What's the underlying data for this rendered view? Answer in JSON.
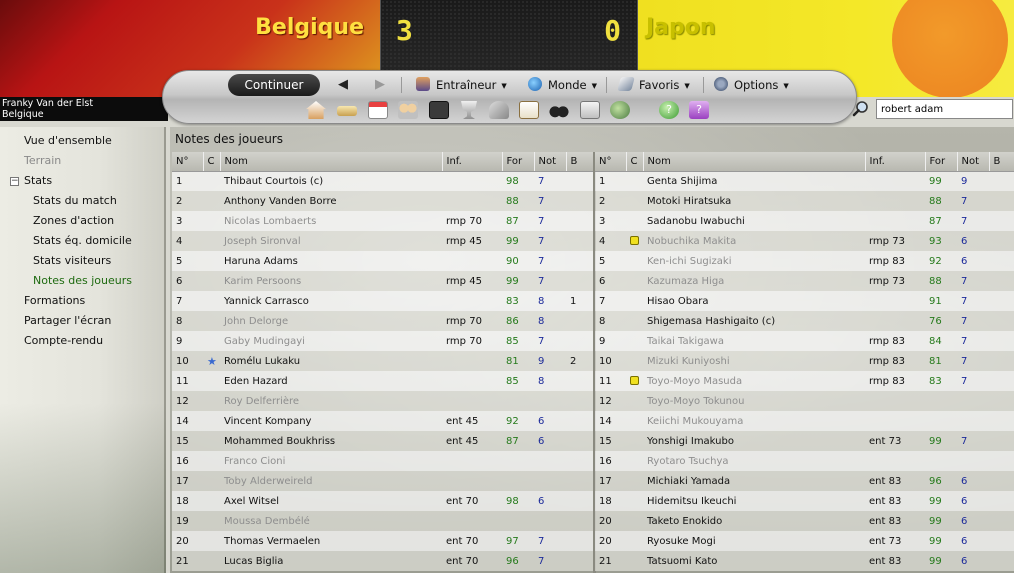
{
  "match": {
    "home_team": "Belgique",
    "away_team": "Japon",
    "home_score": "3",
    "away_score": "0",
    "colors": {
      "home": "#c81a14",
      "away": "#f0e020",
      "score_text": "#f0e040"
    }
  },
  "manager": {
    "name": "Franky Van der Elst",
    "team": "Belgique"
  },
  "toolbar": {
    "continue_label": "Continuer",
    "menus": [
      "Entraîneur",
      "Monde",
      "Favoris",
      "Options"
    ],
    "icons": [
      "home-icon",
      "money-icon",
      "calendar-icon",
      "squad-icon",
      "tactics-icon",
      "trophy-icon",
      "staff-icon",
      "clipboard-icon",
      "scout-icon",
      "news-icon",
      "globe-icon",
      "help-icon",
      "info-icon"
    ]
  },
  "search": {
    "value": "robert adam"
  },
  "sidebar": {
    "items": [
      {
        "label": "Vue d'ensemble",
        "state": "normal"
      },
      {
        "label": "Terrain",
        "state": "disabled"
      },
      {
        "label": "Stats",
        "state": "expanded"
      },
      {
        "label": "Stats du match",
        "state": "normal"
      },
      {
        "label": "Zones d'action",
        "state": "normal"
      },
      {
        "label": "Stats éq. domicile",
        "state": "normal"
      },
      {
        "label": "Stats visiteurs",
        "state": "normal"
      },
      {
        "label": "Notes des joueurs",
        "state": "active"
      },
      {
        "label": "Formations",
        "state": "normal"
      },
      {
        "label": "Partager l'écran",
        "state": "normal"
      },
      {
        "label": "Compte-rendu",
        "state": "normal"
      }
    ]
  },
  "page": {
    "title": "Notes des joueurs",
    "columns": [
      "N°",
      "C",
      "Nom",
      "Inf.",
      "For",
      "Not",
      "B"
    ]
  },
  "home_players": [
    {
      "n": "1",
      "c": "",
      "name": "Thibaut Courtois (c)",
      "inf": "",
      "for": "98",
      "not": "7",
      "b": "",
      "played": true
    },
    {
      "n": "2",
      "c": "",
      "name": "Anthony Vanden Borre",
      "inf": "",
      "for": "88",
      "not": "7",
      "b": "",
      "played": true
    },
    {
      "n": "3",
      "c": "",
      "name": "Nicolas Lombaerts",
      "inf": "rmp 70",
      "for": "87",
      "not": "7",
      "b": "",
      "played": false
    },
    {
      "n": "4",
      "c": "",
      "name": "Joseph Sironval",
      "inf": "rmp 45",
      "for": "99",
      "not": "7",
      "b": "",
      "played": false
    },
    {
      "n": "5",
      "c": "",
      "name": "Haruna Adams",
      "inf": "",
      "for": "90",
      "not": "7",
      "b": "",
      "played": true
    },
    {
      "n": "6",
      "c": "",
      "name": "Karim Persoons",
      "inf": "rmp 45",
      "for": "99",
      "not": "7",
      "b": "",
      "played": false
    },
    {
      "n": "7",
      "c": "",
      "name": "Yannick Carrasco",
      "inf": "",
      "for": "83",
      "not": "8",
      "b": "1",
      "played": true
    },
    {
      "n": "8",
      "c": "",
      "name": "John Delorge",
      "inf": "rmp 70",
      "for": "86",
      "not": "8",
      "b": "",
      "played": false
    },
    {
      "n": "9",
      "c": "",
      "name": "Gaby Mudingayi",
      "inf": "rmp 70",
      "for": "85",
      "not": "7",
      "b": "",
      "played": false
    },
    {
      "n": "10",
      "c": "star",
      "name": "Romélu Lukaku",
      "inf": "",
      "for": "81",
      "not": "9",
      "b": "2",
      "played": true
    },
    {
      "n": "11",
      "c": "",
      "name": "Eden Hazard",
      "inf": "",
      "for": "85",
      "not": "8",
      "b": "",
      "played": true
    },
    {
      "n": "12",
      "c": "",
      "name": "Roy Delferrière",
      "inf": "",
      "for": "",
      "not": "",
      "b": "",
      "played": false
    },
    {
      "n": "14",
      "c": "",
      "name": "Vincent Kompany",
      "inf": "ent 45",
      "for": "92",
      "not": "6",
      "b": "",
      "played": true
    },
    {
      "n": "15",
      "c": "",
      "name": "Mohammed Boukhriss",
      "inf": "ent 45",
      "for": "87",
      "not": "6",
      "b": "",
      "played": true
    },
    {
      "n": "16",
      "c": "",
      "name": "Franco Cioni",
      "inf": "",
      "for": "",
      "not": "",
      "b": "",
      "played": false
    },
    {
      "n": "17",
      "c": "",
      "name": "Toby Alderweireld",
      "inf": "",
      "for": "",
      "not": "",
      "b": "",
      "played": false
    },
    {
      "n": "18",
      "c": "",
      "name": "Axel Witsel",
      "inf": "ent 70",
      "for": "98",
      "not": "6",
      "b": "",
      "played": true
    },
    {
      "n": "19",
      "c": "",
      "name": "Moussa Dembélé",
      "inf": "",
      "for": "",
      "not": "",
      "b": "",
      "played": false
    },
    {
      "n": "20",
      "c": "",
      "name": "Thomas Vermaelen",
      "inf": "ent 70",
      "for": "97",
      "not": "7",
      "b": "",
      "played": true
    },
    {
      "n": "21",
      "c": "",
      "name": "Lucas Biglia",
      "inf": "ent 70",
      "for": "96",
      "not": "7",
      "b": "",
      "played": true
    }
  ],
  "away_players": [
    {
      "n": "1",
      "c": "",
      "name": "Genta Shijima",
      "inf": "",
      "for": "99",
      "not": "9",
      "b": "",
      "played": true
    },
    {
      "n": "2",
      "c": "",
      "name": "Motoki Hiratsuka",
      "inf": "",
      "for": "88",
      "not": "7",
      "b": "",
      "played": true
    },
    {
      "n": "3",
      "c": "",
      "name": "Sadanobu Iwabuchi",
      "inf": "",
      "for": "87",
      "not": "7",
      "b": "",
      "played": true
    },
    {
      "n": "4",
      "c": "yellow",
      "name": "Nobuchika Makita",
      "inf": "rmp 73",
      "for": "93",
      "not": "6",
      "b": "",
      "played": false
    },
    {
      "n": "5",
      "c": "",
      "name": "Ken-ichi Sugizaki",
      "inf": "rmp 83",
      "for": "92",
      "not": "6",
      "b": "",
      "played": false
    },
    {
      "n": "6",
      "c": "",
      "name": "Kazumaza Higa",
      "inf": "rmp 73",
      "for": "88",
      "not": "7",
      "b": "",
      "played": false
    },
    {
      "n": "7",
      "c": "",
      "name": "Hisao Obara",
      "inf": "",
      "for": "91",
      "not": "7",
      "b": "",
      "played": true
    },
    {
      "n": "8",
      "c": "",
      "name": "Shigemasa Hashigaito (c)",
      "inf": "",
      "for": "76",
      "not": "7",
      "b": "",
      "played": true
    },
    {
      "n": "9",
      "c": "",
      "name": "Taikai Takigawa",
      "inf": "rmp 83",
      "for": "84",
      "not": "7",
      "b": "",
      "played": false
    },
    {
      "n": "10",
      "c": "",
      "name": "Mizuki Kuniyoshi",
      "inf": "rmp 83",
      "for": "81",
      "not": "7",
      "b": "",
      "played": false
    },
    {
      "n": "11",
      "c": "yellow",
      "name": "Toyo-Moyo Masuda",
      "inf": "rmp 83",
      "for": "83",
      "not": "7",
      "b": "",
      "played": false
    },
    {
      "n": "12",
      "c": "",
      "name": "Toyo-Moyo Tokunou",
      "inf": "",
      "for": "",
      "not": "",
      "b": "",
      "played": false
    },
    {
      "n": "14",
      "c": "",
      "name": "Keiichi Mukouyama",
      "inf": "",
      "for": "",
      "not": "",
      "b": "",
      "played": false
    },
    {
      "n": "15",
      "c": "",
      "name": "Yonshigi Imakubo",
      "inf": "ent 73",
      "for": "99",
      "not": "7",
      "b": "",
      "played": true
    },
    {
      "n": "16",
      "c": "",
      "name": "Ryotaro Tsuchya",
      "inf": "",
      "for": "",
      "not": "",
      "b": "",
      "played": false
    },
    {
      "n": "17",
      "c": "",
      "name": "Michiaki Yamada",
      "inf": "ent 83",
      "for": "96",
      "not": "6",
      "b": "",
      "played": true
    },
    {
      "n": "18",
      "c": "",
      "name": "Hidemitsu Ikeuchi",
      "inf": "ent 83",
      "for": "99",
      "not": "6",
      "b": "",
      "played": true
    },
    {
      "n": "20",
      "c": "",
      "name": "Taketo Enokido",
      "inf": "ent 83",
      "for": "99",
      "not": "6",
      "b": "",
      "played": true
    },
    {
      "n": "20",
      "c": "",
      "name": "Ryosuke Mogi",
      "inf": "ent 73",
      "for": "99",
      "not": "6",
      "b": "",
      "played": true
    },
    {
      "n": "21",
      "c": "",
      "name": "Tatsuomi Kato",
      "inf": "ent 83",
      "for": "99",
      "not": "6",
      "b": "",
      "played": true
    }
  ]
}
